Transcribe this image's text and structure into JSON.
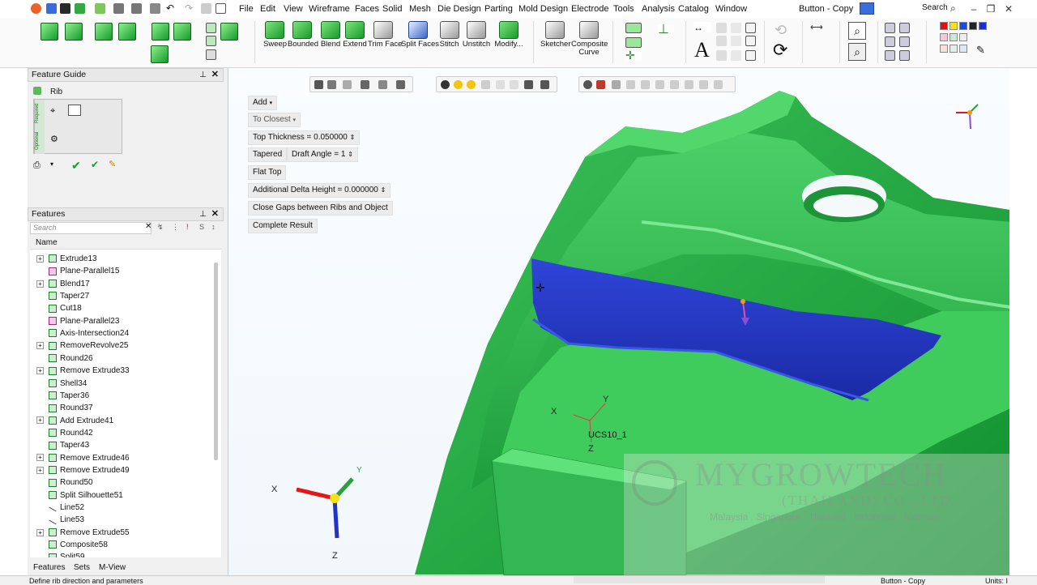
{
  "title": "Button - Copy",
  "search": {
    "label": "Search"
  },
  "menu": [
    "File",
    "Edit",
    "View",
    "Wireframe",
    "Faces",
    "Solid",
    "Mesh",
    "Die Design",
    "Parting",
    "Mold Design",
    "Electrode",
    "Tools",
    "Analysis",
    "Catalog",
    "Window"
  ],
  "ribbon": {
    "sweep": "Sweep",
    "bounded": "Bounded",
    "blend": "Blend",
    "extend": "Extend",
    "trim_face": "Trim Face",
    "split_faces": "Split Faces",
    "stitch": "Stitch",
    "unstitch": "Unstitch",
    "modify": "Modify...",
    "sketcher": "Sketcher",
    "composite_curve_1": "Composite",
    "composite_curve_2": "Curve"
  },
  "feature_guide": {
    "title": "Feature Guide",
    "feature": "Rib",
    "required_tab": "Required",
    "optional_tab": "Optional"
  },
  "features_panel": {
    "title": "Features",
    "search_placeholder": "Search",
    "column_name": "Name",
    "items": [
      {
        "label": "Extrude13",
        "expand": true,
        "type": "solid"
      },
      {
        "label": "Plane-Parallel15",
        "expand": false,
        "type": "plane"
      },
      {
        "label": "Blend17",
        "expand": true,
        "type": "solid"
      },
      {
        "label": "Taper27",
        "expand": false,
        "type": "solid"
      },
      {
        "label": "Cut18",
        "expand": false,
        "type": "solid"
      },
      {
        "label": "Plane-Parallel23",
        "expand": false,
        "type": "plane"
      },
      {
        "label": "Axis-Intersection24",
        "expand": false,
        "type": "solid"
      },
      {
        "label": "RemoveRevolve25",
        "expand": true,
        "type": "solid"
      },
      {
        "label": "Round26",
        "expand": false,
        "type": "solid"
      },
      {
        "label": "Remove Extrude33",
        "expand": true,
        "type": "solid"
      },
      {
        "label": "Shell34",
        "expand": false,
        "type": "solid"
      },
      {
        "label": "Taper36",
        "expand": false,
        "type": "solid"
      },
      {
        "label": "Round37",
        "expand": false,
        "type": "solid"
      },
      {
        "label": "Add Extrude41",
        "expand": true,
        "type": "solid"
      },
      {
        "label": "Round42",
        "expand": false,
        "type": "solid"
      },
      {
        "label": "Taper43",
        "expand": false,
        "type": "solid"
      },
      {
        "label": "Remove Extrude46",
        "expand": true,
        "type": "solid"
      },
      {
        "label": "Remove Extrude49",
        "expand": true,
        "type": "solid"
      },
      {
        "label": "Round50",
        "expand": false,
        "type": "solid"
      },
      {
        "label": "Split Silhouette51",
        "expand": false,
        "type": "solid"
      },
      {
        "label": "Line52",
        "expand": false,
        "type": "line"
      },
      {
        "label": "Line53",
        "expand": false,
        "type": "line"
      },
      {
        "label": "Remove Extrude55",
        "expand": true,
        "type": "solid"
      },
      {
        "label": "Composite58",
        "expand": false,
        "type": "solid"
      },
      {
        "label": "Split59",
        "expand": false,
        "type": "solid"
      }
    ],
    "bottom_tabs": [
      "Features",
      "Sets",
      "M-View"
    ]
  },
  "options": {
    "add": "Add",
    "to_closest": "To Closest",
    "top_thickness": "Top Thickness = 0.050000",
    "tapered": "Tapered",
    "draft_angle": "Draft Angle = 1",
    "flat_top": "Flat Top",
    "additional_delta": "Additional Delta Height = 0.000000",
    "close_gaps": "Close Gaps between Ribs and Object",
    "complete_result": "Complete Result"
  },
  "viewport": {
    "ucs_label": "UCS10_1",
    "axis_x": "X",
    "axis_y": "Y",
    "axis_z": "Z",
    "watermark_name": "MYGROWTECH",
    "watermark_company": "(THAILAND) CO., LTD.",
    "watermark_countries": "Malaysia . Singapore . Thailand . Indonesia . Vietnam"
  },
  "status": {
    "prompt": "Define rib direction and parameters",
    "doc": "Button - Copy",
    "units": "Units: I"
  },
  "colors": {
    "part_green": "#23b04a",
    "rib_blue": "#1d35c8",
    "accent": "#1a6fd8"
  }
}
